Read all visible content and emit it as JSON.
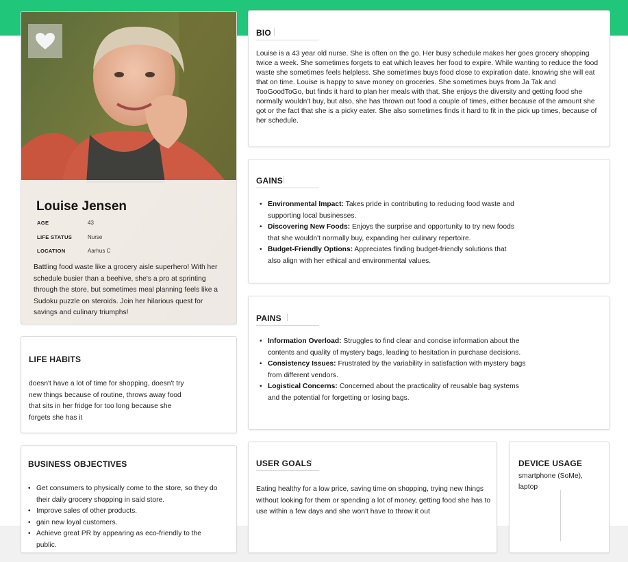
{
  "profile": {
    "name": "Louise Jensen",
    "age_label": "AGE",
    "age": "43",
    "life_status_label": "LIFE STATUS",
    "life_status": "Nurse",
    "location_label": "LOCATION",
    "location": "Aarhus C",
    "quote": "Battling food waste like a grocery aisle superhero! With her schedule busier than a beehive, she's a pro at sprinting through the store, but sometimes meal planning feels like a Sudoku puzzle on steroids. Join her hilarious quest for savings and culinary triumphs!",
    "favorite_icon": "heart-icon"
  },
  "bio": {
    "title": "BIO",
    "text": "Louise is a 43 year old nurse. She is often on the go. Her busy schedule makes her goes grocery shopping twice a week. She sometimes forgets to eat which leaves her food to expire. While wanting to reduce the food waste she sometimes feels helpless. She sometimes buys food close to expiration date, knowing she will eat that on time. Louise is happy to save money on groceries. She sometimes buys from Ja Tak and TooGoodToGo, but finds it hard to plan her meals with that. She enjoys the diversity and getting food she normally wouldn't buy, but also, she has thrown out food a couple of times, either because of the amount she got or the fact that she is a picky eater. She also sometimes finds it hard to fit in the pick up times, because of her schedule."
  },
  "gains": {
    "title": "GAINS",
    "items": [
      {
        "label": "Environmental Impact:",
        "text": " Takes pride in contributing to reducing food waste and supporting local businesses."
      },
      {
        "label": "Discovering New Foods:",
        "text": " Enjoys the surprise and opportunity to try new foods that she wouldn't normally buy, expanding her culinary repertoire."
      },
      {
        "label": "Budget-Friendly Options:",
        "text": " Appreciates finding budget-friendly solutions that also align with her ethical and environmental values."
      }
    ]
  },
  "pains": {
    "title": "PAINS",
    "items": [
      {
        "label": "Information Overload:",
        "text": " Struggles to find clear and concise information about the contents and quality of mystery bags, leading to hesitation in purchase decisions."
      },
      {
        "label": "Consistency Issues:",
        "text": " Frustrated by the variability in satisfaction with mystery bags from different vendors."
      },
      {
        "label": "Logistical Concerns:",
        "text": " Concerned about the practicality of reusable bag systems and the potential for forgetting or losing bags."
      }
    ]
  },
  "life_habits": {
    "title": "LIFE HABITS",
    "text": "doesn't have a lot of time for shopping, doesn't try new things because of routine, throws away food that sits in her fridge for too long because she forgets she has it"
  },
  "business_objectives": {
    "title": "BUSINESS OBJECTIVES",
    "items": [
      "Get consumers to physically come to the store, so they do their daily grocery shopping in said store.",
      "Improve sales of other products.",
      "gain new loyal customers.",
      "Achieve great PR by appearing as eco-friendly to the public."
    ]
  },
  "user_goals": {
    "title": "USER GOALS",
    "text": "Eating healthy for a low price, saving time on shopping, trying new things without looking for them or spending a lot of money, getting food she has to use within a few days and she won't have to throw it out"
  },
  "device_usage": {
    "title": "DEVICE USAGE",
    "text": "smartphone (SoMe), laptop"
  },
  "colors": {
    "accent_green": "#20c77a",
    "footer_gray": "#f1f1f1"
  }
}
